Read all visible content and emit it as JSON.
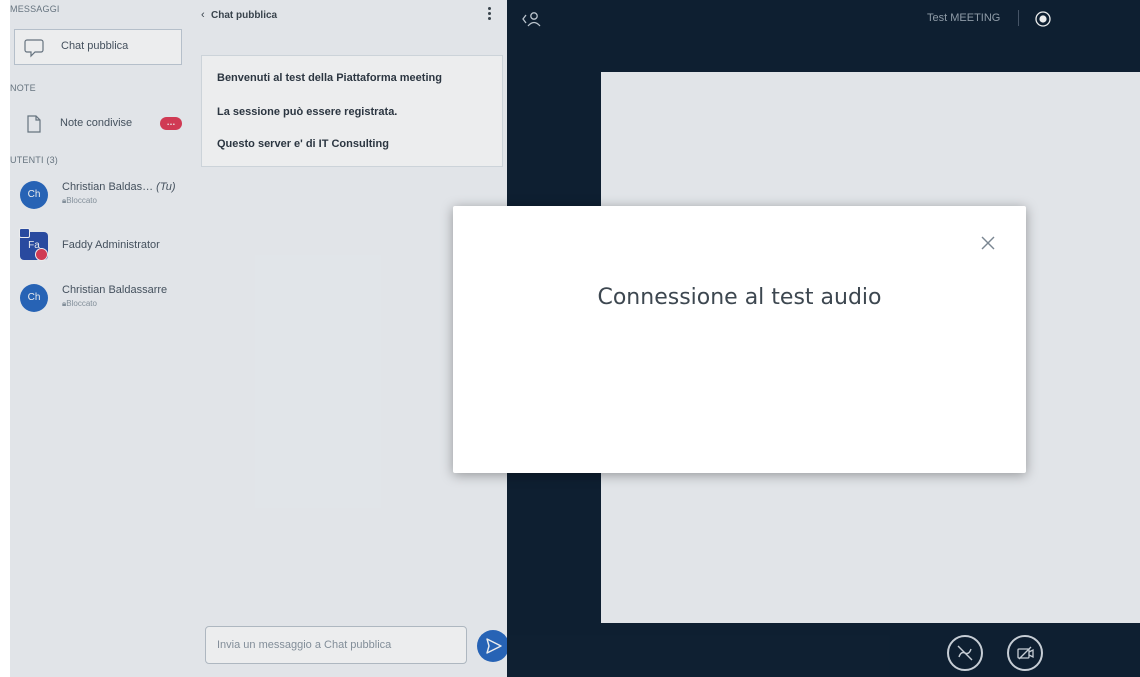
{
  "sidebar": {
    "messages_label": "MESSAGGI",
    "public_chat": "Chat pubblica",
    "notes_label": "NOTE",
    "shared_notes": "Note condivise",
    "notes_badge": "…",
    "users_label": "UTENTI (3)",
    "users": [
      {
        "initials": "Ch",
        "name": "Christian Baldas…",
        "you_tag": "(Tu)",
        "status": "Bloccato"
      },
      {
        "initials": "Fa",
        "name": "Faddy Administrator",
        "you_tag": "",
        "status": ""
      },
      {
        "initials": "Ch",
        "name": "Christian Baldassarre",
        "you_tag": "",
        "status": "Bloccato"
      }
    ]
  },
  "chat": {
    "title": "Chat pubblica",
    "back_icon": "chevron-left-icon",
    "messages": [
      "Benvenuti al test della Piattaforma meeting",
      "La sessione può essere registrata.",
      "Questo server e' di IT Consulting"
    ],
    "input_placeholder": "Invia un messaggio a Chat pubblica"
  },
  "main": {
    "meeting_title": "Test MEETING"
  },
  "modal": {
    "title": "Connessione al test audio"
  },
  "colors": {
    "accent": "#2a6ac2",
    "badge": "#e13d58",
    "main_bg": "#0f2032",
    "panel_bg": "#f3f6f9"
  }
}
